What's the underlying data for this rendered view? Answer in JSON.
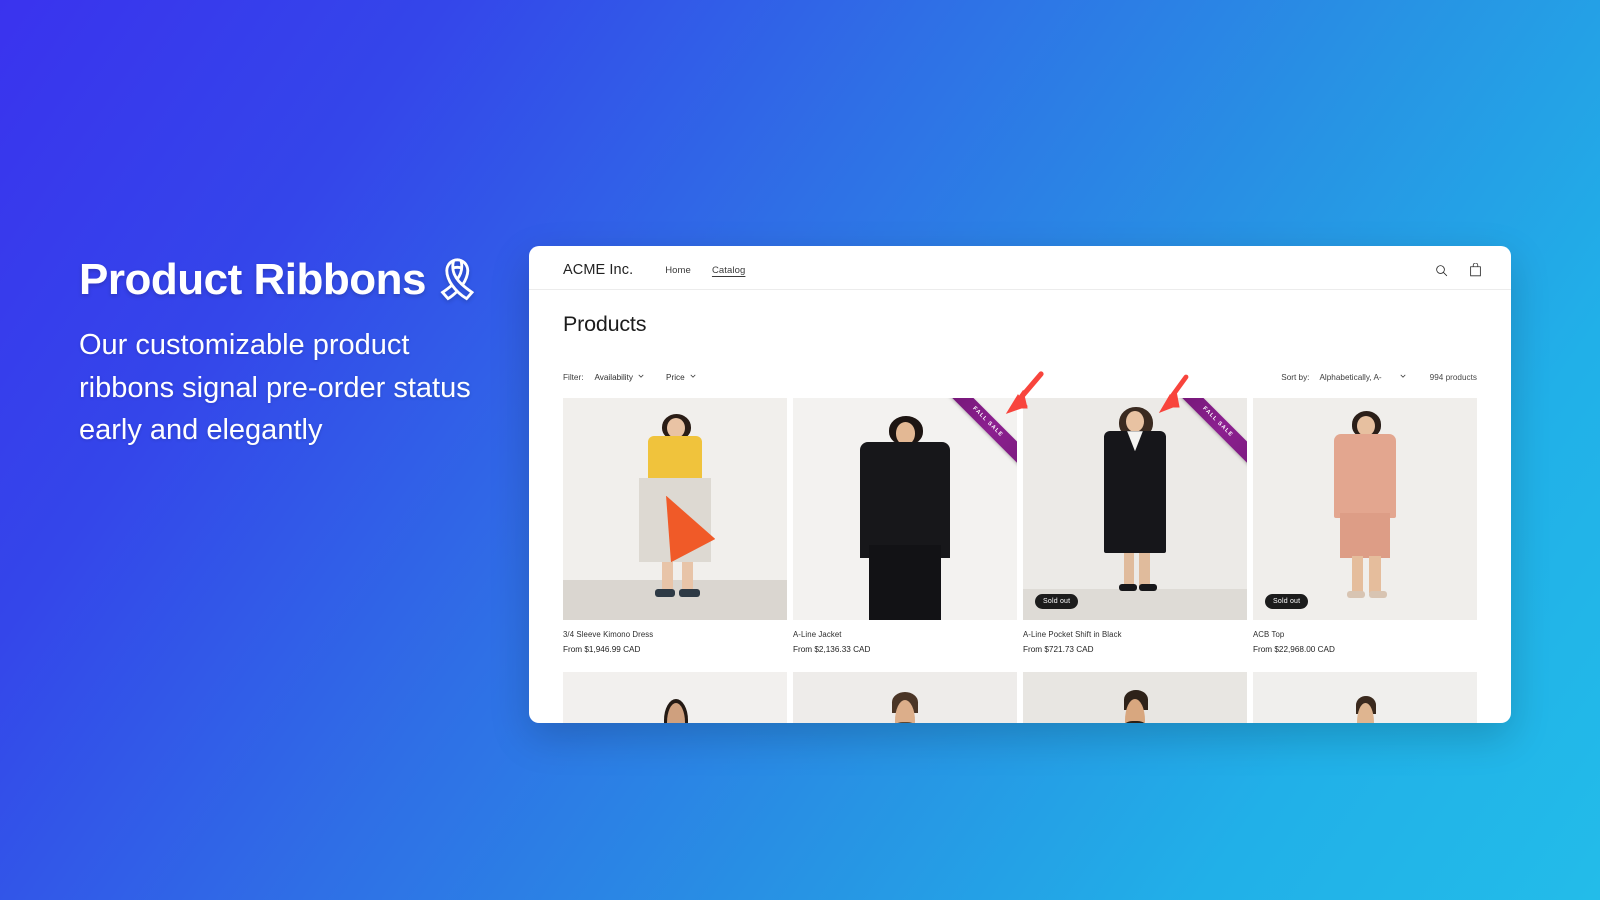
{
  "promo": {
    "title": "Product Ribbons",
    "title_emoji": "🎗",
    "subtitle": "Our customizable product ribbons signal pre-order status early and elegantly"
  },
  "store": {
    "brand": "ACME Inc.",
    "nav": [
      {
        "label": "Home",
        "active": false
      },
      {
        "label": "Catalog",
        "active": true
      }
    ],
    "icons": [
      {
        "name": "search-icon",
        "label": "Search"
      },
      {
        "name": "cart-icon",
        "label": "Cart"
      }
    ]
  },
  "collection": {
    "title": "Products",
    "filter_label": "Filter:",
    "filters": [
      {
        "label": "Availability"
      },
      {
        "label": "Price"
      }
    ],
    "sort_label": "Sort by:",
    "sort_value": "Alphabetically, A-",
    "product_count": "994 products"
  },
  "products": [
    {
      "title": "3/4 Sleeve Kimono Dress",
      "price": "From $1,946.99 CAD",
      "ribbon": null,
      "badge": null
    },
    {
      "title": "A-Line Jacket",
      "price": "From $2,136.33 CAD",
      "ribbon": "FALL SALE",
      "badge": null
    },
    {
      "title": "A-Line Pocket Shift in Black",
      "price": "From $721.73 CAD",
      "ribbon": "FALL SALE",
      "badge": "Sold out"
    },
    {
      "title": "ACB Top",
      "price": "From $22,968.00 CAD",
      "ribbon": null,
      "badge": "Sold out"
    }
  ],
  "colors": {
    "ribbon_purple": "#7c1c7c",
    "badge_black": "#1c1c1c",
    "arrow_red": "#f8443c",
    "bg_start": "#3a33ee",
    "bg_end": "#23bce9"
  }
}
